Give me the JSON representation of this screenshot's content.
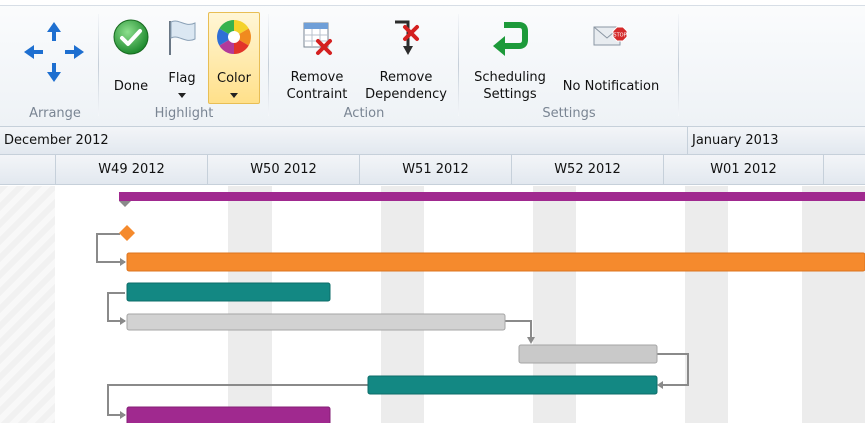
{
  "ribbon": {
    "groups": {
      "arrange": {
        "label": "Arrange"
      },
      "highlight": {
        "label": "Highlight",
        "done_label": "Done",
        "flag_label": "Flag",
        "color_label": "Color"
      },
      "action": {
        "label": "Action",
        "remove_constraint_line1": "Remove",
        "remove_constraint_line2": "Contraint",
        "remove_dependency_line1": "Remove",
        "remove_dependency_line2": "Dependency"
      },
      "settings": {
        "label": "Settings",
        "scheduling_line1": "Scheduling",
        "scheduling_line2": "Settings",
        "no_notification_label": "No Notification"
      }
    }
  },
  "timescale": {
    "months": [
      "December 2012",
      "January 2013"
    ],
    "weeks": [
      "W49 2012",
      "W50 2012",
      "W51 2012",
      "W52 2012",
      "W01 2012"
    ]
  },
  "colors": {
    "purple": "#a0298f",
    "orange": "#f58a2d",
    "teal": "#138883",
    "gray": "#c9c9c9",
    "link": "#8a8a8a",
    "selected": "#ffe08a"
  },
  "icons": {
    "arrange": "move-arrows-icon",
    "done": "checkmark-icon",
    "flag": "flag-icon",
    "color": "color-wheel-icon",
    "remove_constraint": "calendar-remove-icon",
    "remove_dependency": "link-remove-icon",
    "scheduling": "green-arrow-icon",
    "no_notification": "stop-mail-icon"
  }
}
